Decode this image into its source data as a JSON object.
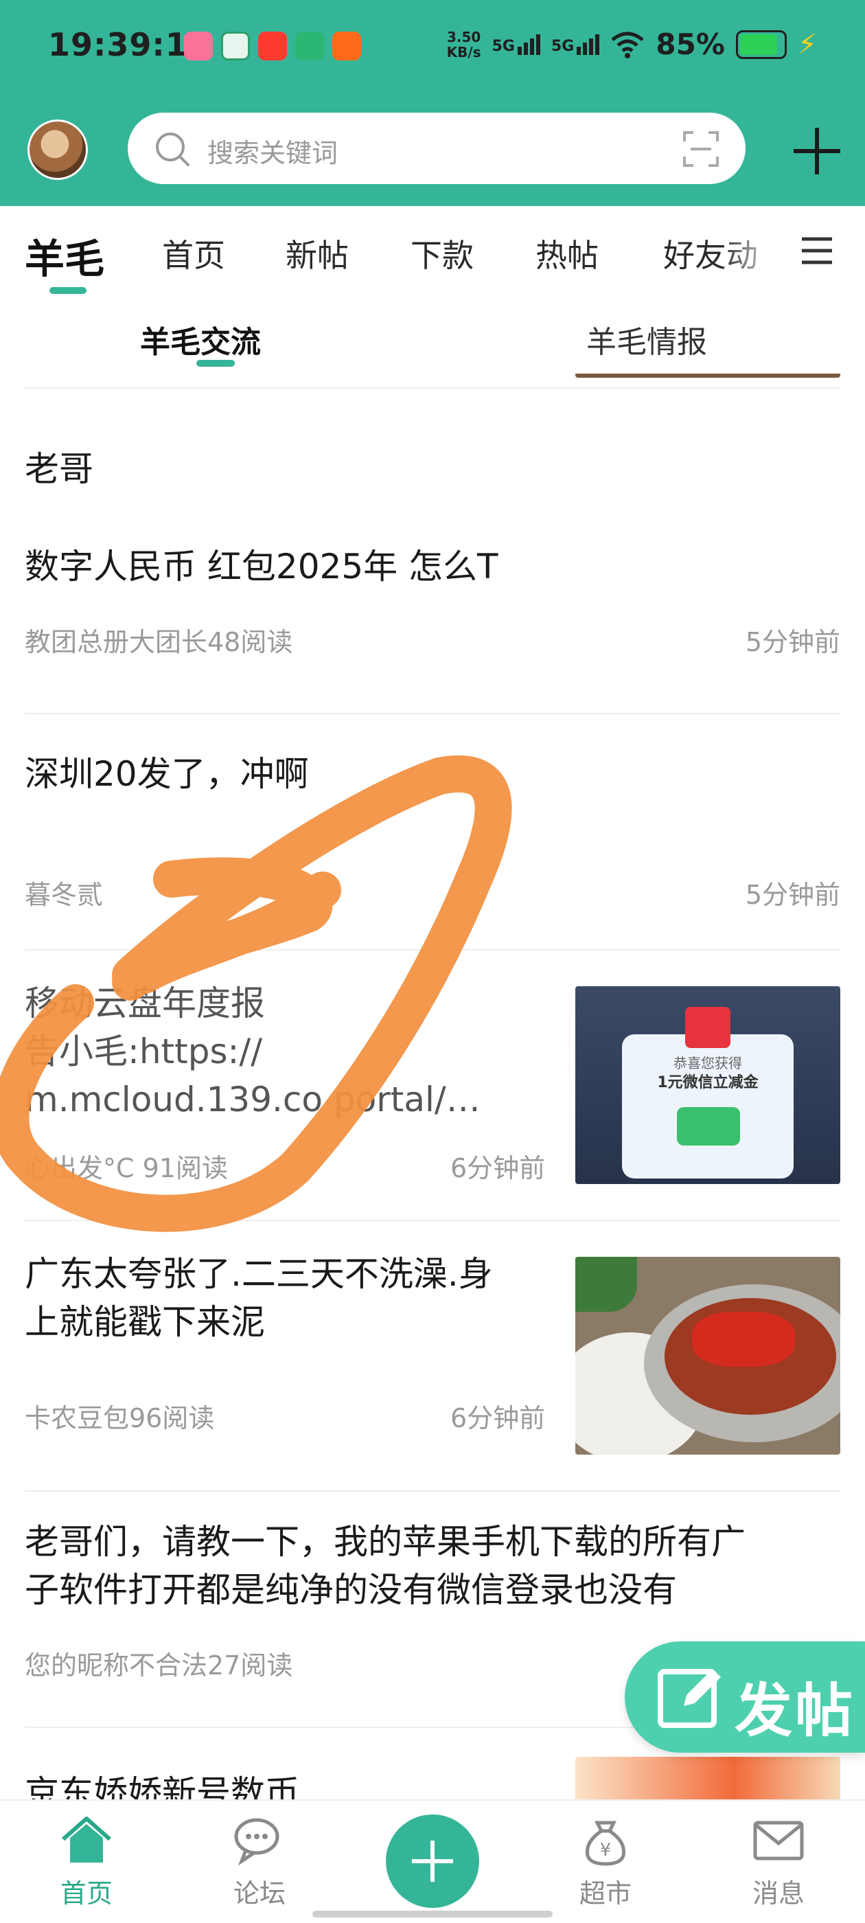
{
  "status_bar": {
    "time": "19:39:13",
    "net_speed_top": "3.50",
    "net_speed_bottom": "KB/s",
    "signal1": "5G",
    "signal2": "5G",
    "battery": "85%",
    "colors": {
      "bar": "#35b598"
    }
  },
  "header": {
    "search_placeholder": "搜索关键词",
    "icons": [
      "avatar",
      "search-icon",
      "scan-icon",
      "plus-icon"
    ]
  },
  "tabs": {
    "items": [
      "羊毛",
      "首页",
      "新帖",
      "下款",
      "热帖",
      "好友动"
    ],
    "active": "羊毛",
    "menu_icon": "menu-icon"
  },
  "subtabs": {
    "items": [
      "羊毛交流",
      "羊毛情报"
    ],
    "active": "羊毛交流"
  },
  "posts": [
    {
      "title": "老哥",
      "title2": "数字人民币 红包2025年 怎么T",
      "meta": "教团总册大团长48阅读",
      "ago": "5分钟前"
    },
    {
      "title": "深圳20发了，冲啊",
      "meta": "暮冬贰",
      "ago": "5分钟前"
    },
    {
      "title_line1": "移动云盘年度报",
      "title_line2": "告小毛:https://",
      "title_line3": "m.mcloud.139.co   portal/…",
      "meta": "心出发°C   91阅读",
      "ago": "6分钟前",
      "thumb_text_top": "恭喜您获得",
      "thumb_text_main": "1元微信立减金"
    },
    {
      "title_line1": "广东太夸张了.二三天不洗澡.身",
      "title_line2": "上就能戳下来泥",
      "meta": "卡农豆包96阅读",
      "ago": "6分钟前"
    },
    {
      "title_line1": "老哥们，请教一下，我的苹果手机下载的所有广",
      "title_line2": "子软件打开都是纯净的没有微信登录也没有",
      "meta": "您的昵称不合法27阅读"
    },
    {
      "title": "京东娇娇新号数币"
    }
  ],
  "fab": {
    "label": "发帖"
  },
  "bottom_nav": {
    "items": [
      "首页",
      "论坛",
      "超市",
      "消息"
    ],
    "active": "首页"
  }
}
